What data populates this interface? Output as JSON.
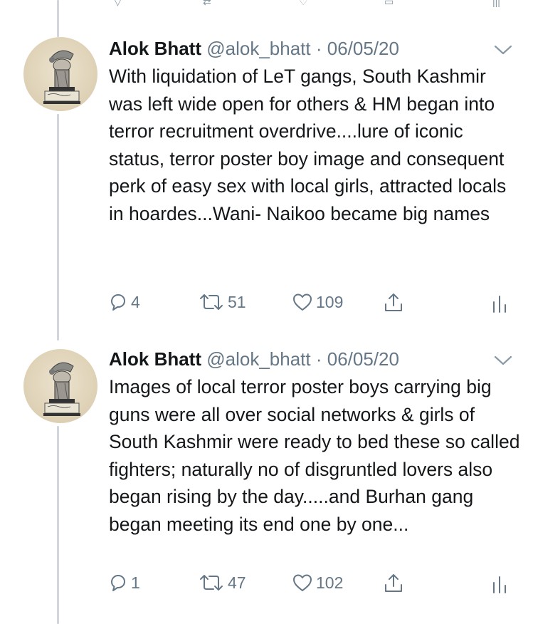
{
  "tweets": [
    {
      "author_name": "Alok Bhatt",
      "handle": "@alok_bhatt",
      "separator": "·",
      "date": "06/05/20",
      "text": "With liquidation of LeT gangs, South Kashmir was left wide open for others & HM began into terror recruitment overdrive....lure of iconic status, terror poster boy image and consequent perk of easy sex with local girls, attracted locals in hoardes...Wani- Naikoo became big names",
      "reply_count": "4",
      "retweet_count": "51",
      "like_count": "109"
    },
    {
      "author_name": "Alok Bhatt",
      "handle": "@alok_bhatt",
      "separator": "·",
      "date": "06/05/20",
      "text": "Images of local terror poster boys carrying big guns were all over social networks & girls of South Kashmir were ready to bed these so called fighters; naturally no of disgruntled lovers also began rising by the day.....and Burhan gang began meeting its end one by one...",
      "reply_count": "1",
      "retweet_count": "47",
      "like_count": "102"
    }
  ],
  "icons": {
    "reply": "reply-icon",
    "retweet": "retweet-icon",
    "like": "heart-icon",
    "share": "share-icon",
    "analytics": "analytics-icon",
    "caret": "chevron-down-icon"
  },
  "colors": {
    "text": "#14171a",
    "secondary": "#657786",
    "thread_line": "#d0d6db",
    "background": "#ffffff"
  }
}
